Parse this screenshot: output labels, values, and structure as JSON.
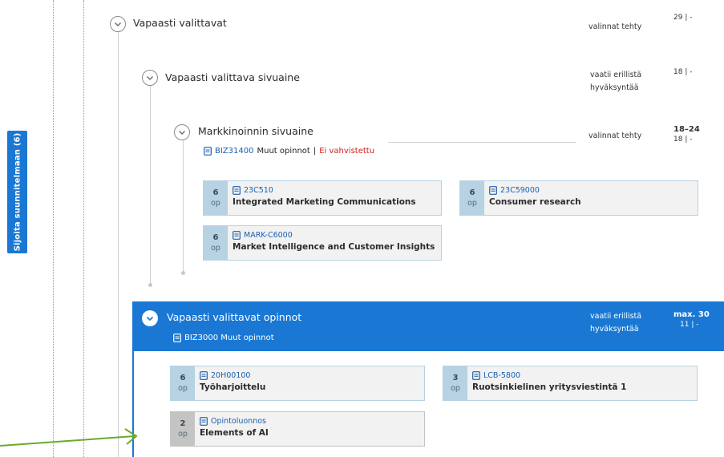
{
  "sidebar": {
    "place_button_label": "Sijoita suunnitelmaan (6)"
  },
  "groups": [
    {
      "title": "Vapaasti valittavat",
      "status": [
        "valinnat tehty"
      ],
      "count_main": "",
      "count_sub": "29 | -"
    },
    {
      "title": "Vapaasti valittava sivuaine",
      "status": [
        "vaatii erillistä",
        "hyväksyntää"
      ],
      "count_main": "",
      "count_sub": "18 | -"
    },
    {
      "title": "Markkinoinnin sivuaine",
      "status": [
        "valinnat tehty"
      ],
      "count_main": "18–24",
      "count_sub": "18 | -",
      "code": "BIZ31400",
      "kind": "Muut opinnot",
      "sep": "|",
      "state": "Ei vahvistettu"
    },
    {
      "title": "Vapaasti valittavat opinnot",
      "status": [
        "vaatii erillistä",
        "hyväksyntää"
      ],
      "count_main": "max. 30",
      "count_sub": "11 | -",
      "code_line": "BIZ3000 Muut opinnot"
    }
  ],
  "marketing_courses": [
    {
      "credits": "6",
      "unit": "op",
      "code": "23C510",
      "name": "Integrated Marketing Communications"
    },
    {
      "credits": "6",
      "unit": "op",
      "code": "23C59000",
      "name": "Consumer research"
    },
    {
      "credits": "6",
      "unit": "op",
      "code": "MARK-C6000",
      "name": "Market Intelligence and Customer Insights"
    }
  ],
  "free_courses": [
    {
      "credits": "6",
      "unit": "op",
      "code": "20H00100",
      "name": "Työharjoittelu"
    },
    {
      "credits": "3",
      "unit": "op",
      "code": "LCB-5800",
      "name": "Ruotsinkielinen yritysviestintä 1"
    },
    {
      "credits": "2",
      "unit": "op",
      "code": "Opintoluonnos",
      "name": "Elements of AI"
    }
  ],
  "colors": {
    "accent": "#1a78d4",
    "credit_blue": "#b6d2e3",
    "credit_gray": "#c4c4c4",
    "arrow": "#6aaa2a",
    "warning": "#d32020"
  },
  "icons": [
    "chevron-down-icon",
    "document-icon",
    "arrow-icon"
  ]
}
